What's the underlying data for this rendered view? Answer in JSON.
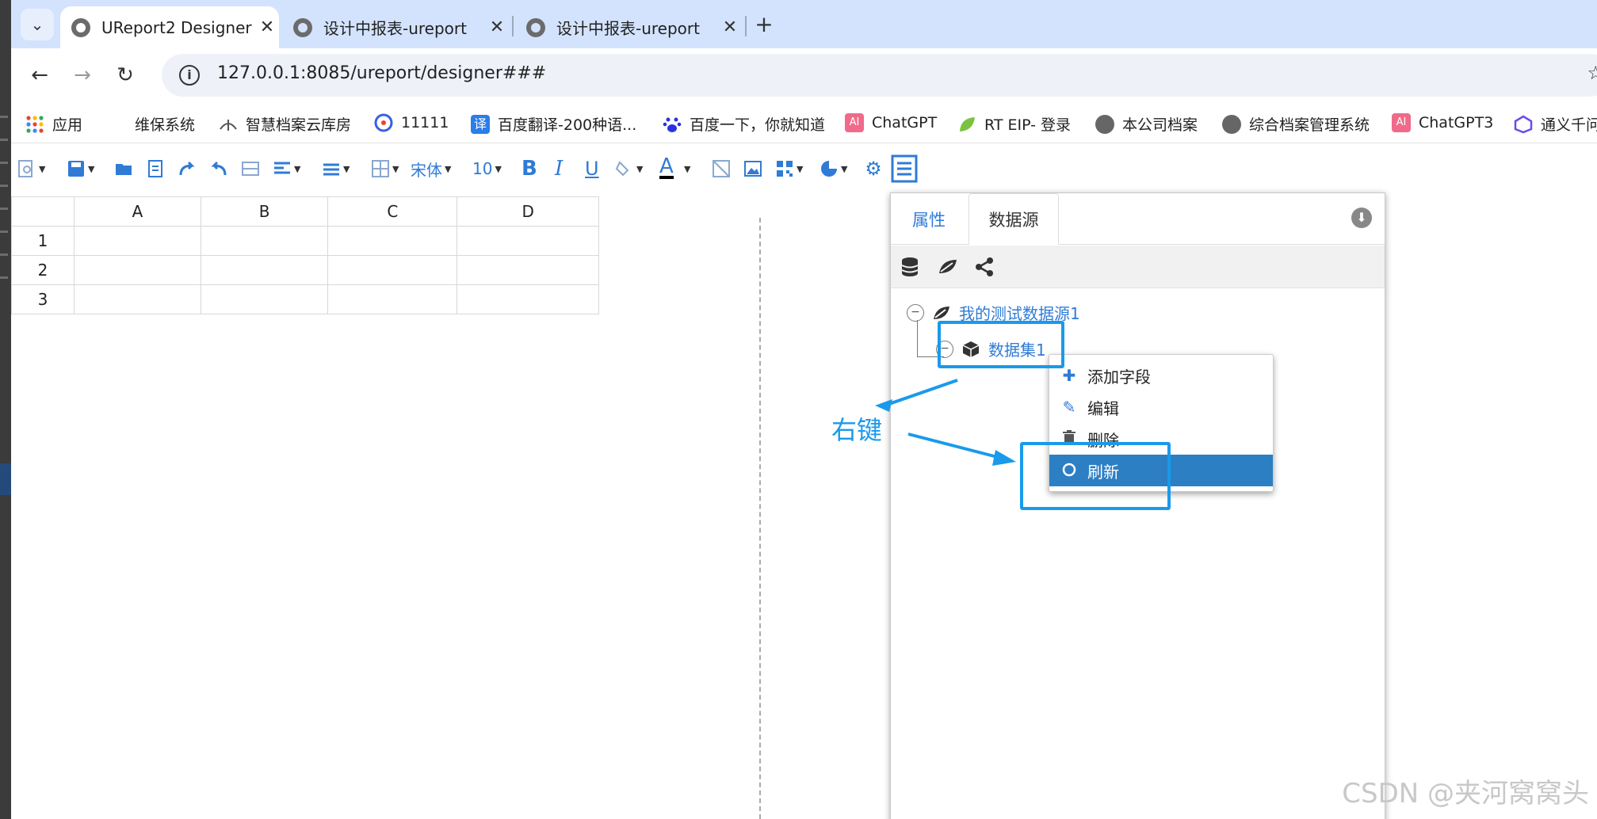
{
  "browser": {
    "tabs": [
      {
        "title": "UReport2 Designer",
        "active": true
      },
      {
        "title": "设计中报表-ureport",
        "active": false
      },
      {
        "title": "设计中报表-ureport",
        "active": false
      }
    ],
    "new_tab": "+",
    "tab_menu": "⌄",
    "url": "127.0.0.1:8085/ureport/designer###"
  },
  "bookmarks": [
    {
      "label": "应用",
      "icon": "apps-grid-icon"
    },
    {
      "label": "维保系统",
      "icon": ""
    },
    {
      "label": "智慧档案云库房",
      "icon": "leaf-icon"
    },
    {
      "label": "11111",
      "icon": "q-icon"
    },
    {
      "label": "百度翻译-200种语...",
      "icon": "translate-icon"
    },
    {
      "label": "百度一下，你就知道",
      "icon": "baidu-paw-icon"
    },
    {
      "label": "ChatGPT",
      "icon": "ai-icon"
    },
    {
      "label": "RT EIP- 登录",
      "icon": "leaf-green-icon"
    },
    {
      "label": "本公司档案",
      "icon": "globe-icon"
    },
    {
      "label": "综合档案管理系统",
      "icon": "globe-icon"
    },
    {
      "label": "ChatGPT3",
      "icon": "ai-icon"
    },
    {
      "label": "通义千问",
      "icon": "tongyi-icon"
    }
  ],
  "toolbar": {
    "font_name": "宋体",
    "font_size": "10"
  },
  "sheet": {
    "columns": [
      "A",
      "B",
      "C",
      "D"
    ],
    "rows": [
      "1",
      "2",
      "3"
    ]
  },
  "panel": {
    "tabs": [
      {
        "label": "属性",
        "active": false
      },
      {
        "label": "数据源",
        "active": true
      }
    ],
    "tree": {
      "datasource": "我的测试数据源1",
      "dataset": "数据集1"
    }
  },
  "context_menu": {
    "items": [
      {
        "label": "添加字段",
        "icon": "plus-icon",
        "selected": false
      },
      {
        "label": "编辑",
        "icon": "edit-icon",
        "selected": false
      },
      {
        "label": "删除",
        "icon": "trash-icon",
        "selected": false
      },
      {
        "label": "刷新",
        "icon": "refresh-icon",
        "selected": true
      }
    ]
  },
  "annotation": {
    "text": "右键",
    "color": "#1a9aea"
  },
  "watermark": "CSDN @夹河窝窝头",
  "colors": {
    "accent": "#2f7bd6",
    "menu_selected": "#2d7fc4",
    "tab_strip": "#d3e3fd"
  }
}
